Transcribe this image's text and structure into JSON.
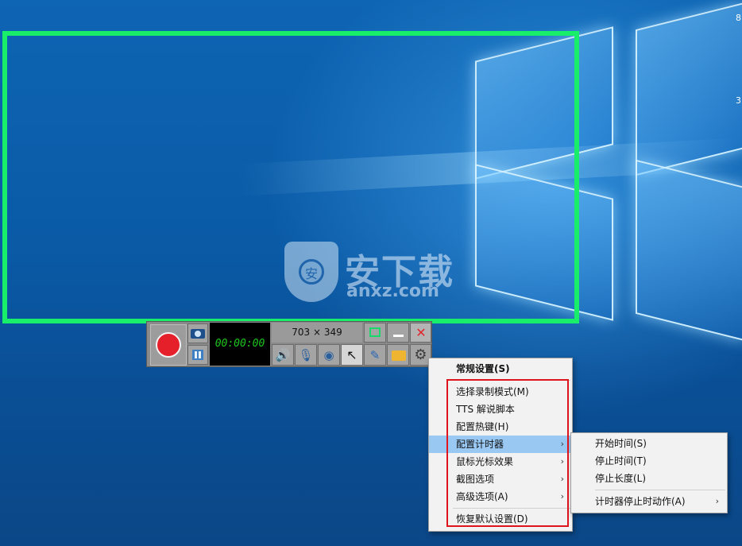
{
  "desktop": {
    "edge_text_top": "8",
    "edge_text_mid": "3"
  },
  "watermark": {
    "shield_char": "安",
    "brand_text": "安下载",
    "url_text": "anxz.com"
  },
  "toolbar": {
    "timer": "00:00:00",
    "capture_size": "703 × 349",
    "close_glyph": "✕",
    "icons": [
      "camera-icon",
      "pause-icon",
      "frame-icon",
      "minimize-icon",
      "close-icon",
      "speaker-icon",
      "microphone-icon",
      "webcam-icon",
      "cursor-icon",
      "pen-icon",
      "folder-icon",
      "gear-icon"
    ],
    "speaker_glyph": "🔊",
    "mic_glyph": "🎙",
    "webcam_glyph": "◉",
    "cursor_glyph": "↖",
    "pen_glyph": "✎",
    "gear_glyph": "⚙"
  },
  "colors": {
    "frame_green": "#18ee6a",
    "record_red": "#e5202a",
    "highlight_red": "#e0141c",
    "menu_active": "#99c9f3",
    "timer_green": "#1ec51e"
  },
  "context_menu": {
    "items": [
      {
        "label": "常规设置(S)",
        "bold": true
      },
      {
        "label": "选择录制模式(M)"
      },
      {
        "label": "TTS 解说脚本"
      },
      {
        "label": "配置热键(H)"
      },
      {
        "label": "配置计时器",
        "submenu": true,
        "active": true
      },
      {
        "label": "鼠标光标效果",
        "submenu": true
      },
      {
        "label": "截图选项",
        "submenu": true
      },
      {
        "label": "高级选项(A)",
        "submenu": true
      },
      {
        "label": "恢复默认设置(D)"
      }
    ],
    "arrow": "›"
  },
  "timer_submenu": {
    "items": [
      {
        "label": "开始时间(S)"
      },
      {
        "label": "停止时间(T)"
      },
      {
        "label": "停止长度(L)"
      },
      {
        "label": "计时器停止时动作(A)",
        "submenu": true
      }
    ],
    "arrow": "›"
  }
}
